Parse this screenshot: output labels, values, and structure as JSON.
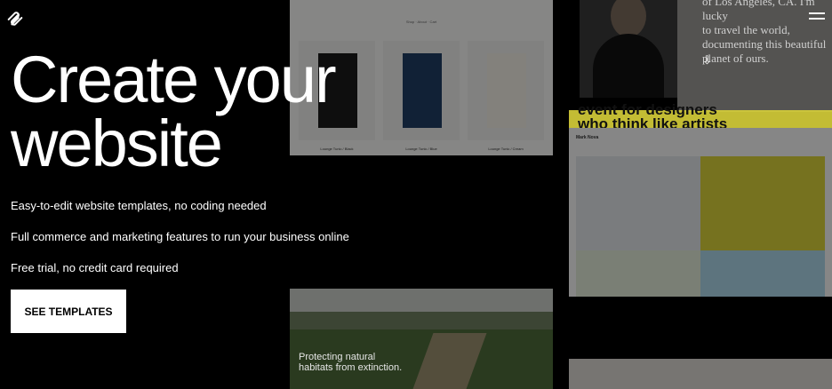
{
  "hero": {
    "title": "Create your\nwebsite",
    "bullets": [
      "Easy-to-edit website templates, no coding needed",
      "Full commerce and marketing features to run your business online",
      "Free trial, no credit card required"
    ],
    "cta_label": "SEE TEMPLATES"
  },
  "previews": {
    "shop_nav": "Shop  ·  About  ·  Cart",
    "products": [
      {
        "caption": "Lounge Tunic / Black",
        "color": "#1a1a1a"
      },
      {
        "caption": "Lounge Tunic / Blue",
        "color": "#1f3c63"
      },
      {
        "caption": "Lounge Tunic / Cream",
        "color": "#efece2"
      }
    ],
    "bio_text": "of Los Angeles, CA. I'm lucky\nto travel the world,\ndocumenting this beautiful\nplanet of ours.",
    "band_text": "event for designers\nwho think like artists",
    "studio_title": "Mark Nova",
    "nature_text": "Protecting natural\nhabitats from extinction."
  },
  "colors": {
    "accent_yellow": "#d8d03a",
    "background": "#000000",
    "cta_bg": "#ffffff"
  }
}
